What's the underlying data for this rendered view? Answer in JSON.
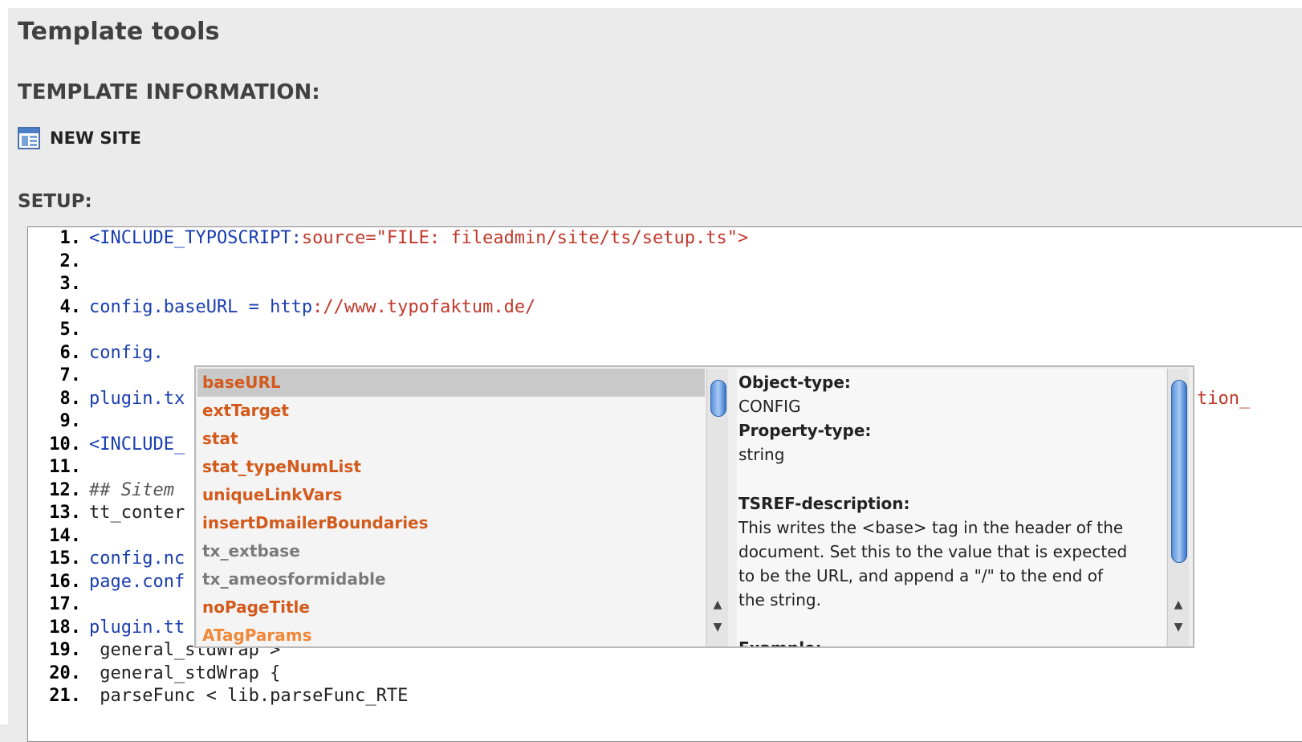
{
  "header": {
    "tools_title": "Template tools",
    "info_title": "TEMPLATE INFORMATION:",
    "site_icon": "template-page-icon",
    "site_name": "NEW SITE",
    "setup_title": "SETUP:"
  },
  "editor": {
    "lines": [
      {
        "n": "1.",
        "parts": [
          {
            "t": "<INCLUDE_TYPOSCRIPT:",
            "c": "c-blue"
          },
          {
            "t": "source=\"FILE: fileadmin/site/ts/setup.ts\">",
            "c": "c-red"
          }
        ]
      },
      {
        "n": "2.",
        "parts": []
      },
      {
        "n": "3.",
        "parts": []
      },
      {
        "n": "4.",
        "parts": [
          {
            "t": "config.baseURL = http",
            "c": "c-blue"
          },
          {
            "t": "://www.typofaktum.de/",
            "c": "c-red"
          }
        ]
      },
      {
        "n": "5.",
        "parts": []
      },
      {
        "n": "6.",
        "parts": [
          {
            "t": "config.",
            "c": "c-blue"
          }
        ]
      },
      {
        "n": "7.",
        "parts": []
      },
      {
        "n": "8.",
        "parts": [
          {
            "t": "plugin.tx",
            "c": "c-blue"
          }
        ]
      },
      {
        "n": "9.",
        "parts": []
      },
      {
        "n": "10.",
        "parts": [
          {
            "t": "<INCLUDE_",
            "c": "c-blue"
          }
        ]
      },
      {
        "n": "11.",
        "parts": []
      },
      {
        "n": "12.",
        "parts": [
          {
            "t": "## Sitem",
            "c": "c-comment"
          }
        ]
      },
      {
        "n": "13.",
        "parts": [
          {
            "t": "tt_conter",
            "c": "c-black"
          }
        ]
      },
      {
        "n": "14.",
        "parts": []
      },
      {
        "n": "15.",
        "parts": [
          {
            "t": "config.nc",
            "c": "c-blue"
          }
        ]
      },
      {
        "n": "16.",
        "parts": [
          {
            "t": "page.conf",
            "c": "c-blue"
          }
        ]
      },
      {
        "n": "17.",
        "parts": []
      },
      {
        "n": "18.",
        "parts": [
          {
            "t": "plugin.tt",
            "c": "c-blue"
          }
        ]
      },
      {
        "n": "19.",
        "parts": [
          {
            "t": " general_stdWrap >",
            "c": "c-black"
          }
        ]
      },
      {
        "n": "20.",
        "parts": [
          {
            "t": " general_stdWrap {",
            "c": "c-black"
          }
        ]
      },
      {
        "n": "21.",
        "parts": [
          {
            "t": " parseFunc < lib.parseFunc_RTE",
            "c": "c-black"
          }
        ]
      }
    ],
    "overflow_text": "tion_"
  },
  "autocomplete": {
    "items": [
      {
        "label": "baseURL",
        "style": "sel"
      },
      {
        "label": "extTarget",
        "style": ""
      },
      {
        "label": "stat",
        "style": ""
      },
      {
        "label": "stat_typeNumList",
        "style": ""
      },
      {
        "label": "uniqueLinkVars",
        "style": ""
      },
      {
        "label": "insertDmailerBoundaries",
        "style": ""
      },
      {
        "label": "tx_extbase",
        "style": "grey"
      },
      {
        "label": "tx_ameosformidable",
        "style": "grey"
      },
      {
        "label": "noPageTitle",
        "style": ""
      },
      {
        "label": "ATagParams",
        "style": "light"
      }
    ],
    "description": {
      "object_type_label": "Object-type:",
      "object_type": "CONFIG",
      "property_type_label": "Property-type:",
      "property_type": "string",
      "tsref_label": "TSREF-description:",
      "tsref_lines": [
        "This writes the <base> tag in the header of the",
        "document. Set this to the value that is expected",
        "to be the URL, and append a \"/\" to the end of",
        "the string."
      ],
      "example_label": "Example:"
    },
    "arrows": {
      "up": "▲",
      "down": "▼"
    }
  }
}
